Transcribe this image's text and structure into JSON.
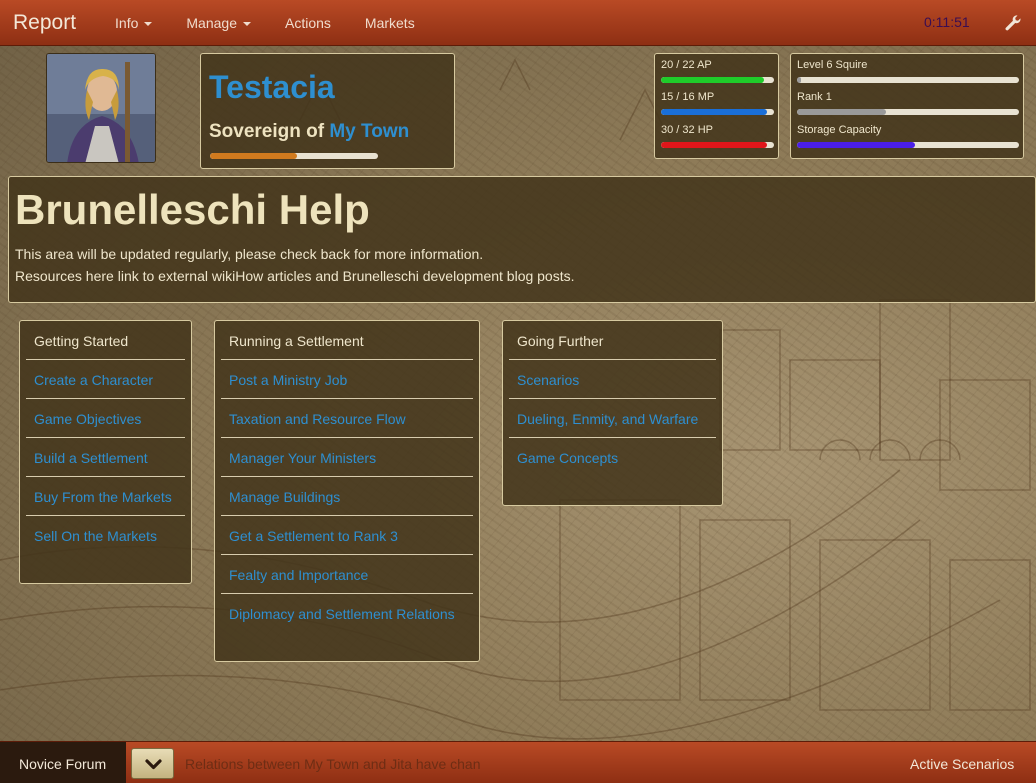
{
  "navbar": {
    "brand": "Report",
    "items": [
      {
        "label": "Info",
        "dropdown": true
      },
      {
        "label": "Manage",
        "dropdown": true
      },
      {
        "label": "Actions",
        "dropdown": false
      },
      {
        "label": "Markets",
        "dropdown": false
      }
    ],
    "clock": "0:11:51",
    "settings_icon": "wrench-icon"
  },
  "character": {
    "name": "Testacia",
    "title_prefix": "Sovereign of",
    "town": "My Town",
    "progress": 0.52,
    "avatar_icon": "character-portrait"
  },
  "stats": [
    {
      "label": "20 / 22 AP",
      "fraction": 0.909,
      "color": "#1fcc2a"
    },
    {
      "label": "15 / 16 MP",
      "fraction": 0.9375,
      "color": "#1a6fd8"
    },
    {
      "label": "30 / 32 HP",
      "fraction": 0.9375,
      "color": "#e0161a"
    }
  ],
  "rank": [
    {
      "label": "Level 6 Squire",
      "fraction": 0.02,
      "color": "#9a9a9a"
    },
    {
      "label": "Rank 1",
      "fraction": 0.4,
      "color": "#9a9a9a"
    },
    {
      "label": "Storage Capacity",
      "fraction": 0.53,
      "color": "#4a1ee8"
    }
  ],
  "help": {
    "title": "Brunelleschi Help",
    "line1": "This area will be updated regularly, please check back for more information.",
    "line2": "Resources here link to external wikiHow articles and Brunelleschi development blog posts."
  },
  "columns": [
    {
      "heading": "Getting Started",
      "links": [
        "Create a Character",
        "Game Objectives",
        "Build a Settlement",
        "Buy From the Markets",
        "Sell On the Markets"
      ]
    },
    {
      "heading": "Running a Settlement",
      "links": [
        "Post a Ministry Job",
        "Taxation and Resource Flow",
        "Manager Your Ministers",
        "Manage Buildings",
        "Get a Settlement to Rank 3",
        "Fealty and Importance",
        "Diplomacy and Settlement Relations"
      ]
    },
    {
      "heading": "Going Further",
      "links": [
        "Scenarios",
        "Dueling, Enmity, and Warfare",
        "Game Concepts"
      ]
    }
  ],
  "footer": {
    "forum_label": "Novice Forum",
    "ticker": "Relations between My Town and Jita have chan",
    "scenarios_label": "Active Scenarios",
    "expand_icon": "chevron-down-icon"
  }
}
